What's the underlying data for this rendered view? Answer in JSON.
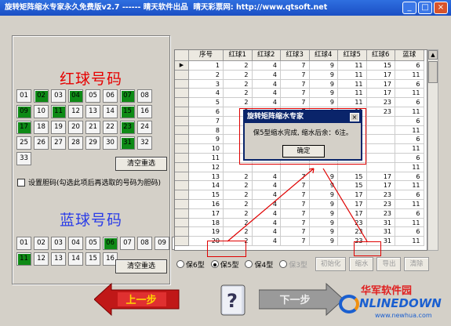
{
  "window": {
    "title": "旋转矩阵缩水专家永久免费版v2.7 ------ 晴天软件出品  晴天彩票网: http://www.qtsoft.net",
    "minimize": "_",
    "maximize": "□",
    "close": "×"
  },
  "red_heading": "红球号码",
  "blue_heading": "蓝球号码",
  "red_balls": [
    {
      "n": "01",
      "on": false
    },
    {
      "n": "02",
      "on": true
    },
    {
      "n": "03",
      "on": false
    },
    {
      "n": "04",
      "on": true
    },
    {
      "n": "05",
      "on": false
    },
    {
      "n": "06",
      "on": false
    },
    {
      "n": "07",
      "on": true
    },
    {
      "n": "08",
      "on": false
    },
    {
      "n": "09",
      "on": true
    },
    {
      "n": "10",
      "on": false
    },
    {
      "n": "11",
      "on": true
    },
    {
      "n": "12",
      "on": false
    },
    {
      "n": "13",
      "on": false
    },
    {
      "n": "14",
      "on": false
    },
    {
      "n": "15",
      "on": true
    },
    {
      "n": "16",
      "on": false
    },
    {
      "n": "17",
      "on": true
    },
    {
      "n": "18",
      "on": false
    },
    {
      "n": "19",
      "on": false
    },
    {
      "n": "20",
      "on": false
    },
    {
      "n": "21",
      "on": false
    },
    {
      "n": "22",
      "on": false
    },
    {
      "n": "23",
      "on": true
    },
    {
      "n": "24",
      "on": false
    },
    {
      "n": "25",
      "on": false
    },
    {
      "n": "26",
      "on": false
    },
    {
      "n": "27",
      "on": false
    },
    {
      "n": "28",
      "on": false
    },
    {
      "n": "29",
      "on": false
    },
    {
      "n": "30",
      "on": false
    },
    {
      "n": "31",
      "on": true
    },
    {
      "n": "32",
      "on": false
    },
    {
      "n": "33",
      "on": false
    }
  ],
  "blue_balls": [
    {
      "n": "01",
      "on": false
    },
    {
      "n": "02",
      "on": false
    },
    {
      "n": "03",
      "on": false
    },
    {
      "n": "04",
      "on": false
    },
    {
      "n": "05",
      "on": false
    },
    {
      "n": "06",
      "on": true
    },
    {
      "n": "07",
      "on": false
    },
    {
      "n": "08",
      "on": false
    },
    {
      "n": "09",
      "on": false
    },
    {
      "n": "10",
      "on": false
    },
    {
      "n": "11",
      "on": true
    },
    {
      "n": "12",
      "on": false
    },
    {
      "n": "13",
      "on": false
    },
    {
      "n": "14",
      "on": false
    },
    {
      "n": "15",
      "on": false
    },
    {
      "n": "16",
      "on": false
    }
  ],
  "clear_label": "清空重选",
  "bile_checkbox_label": "设置胆码(勾选此项后再选取的号码为胆码)",
  "table": {
    "headers": [
      "序号",
      "红球1",
      "红球2",
      "红球3",
      "红球4",
      "红球5",
      "红球6",
      "蓝球"
    ],
    "rows": [
      [
        "1",
        "2",
        "4",
        "7",
        "9",
        "11",
        "15",
        "6"
      ],
      [
        "2",
        "2",
        "4",
        "7",
        "9",
        "11",
        "17",
        "11"
      ],
      [
        "3",
        "2",
        "4",
        "7",
        "9",
        "11",
        "17",
        "6"
      ],
      [
        "4",
        "2",
        "4",
        "7",
        "9",
        "11",
        "17",
        "11"
      ],
      [
        "5",
        "2",
        "4",
        "7",
        "9",
        "11",
        "23",
        "6"
      ],
      [
        "6",
        "2",
        "4",
        "7",
        "9",
        "11",
        "23",
        "11"
      ],
      [
        "7",
        "2",
        "4",
        "7",
        "9",
        "11",
        "",
        "6"
      ],
      [
        "8",
        "",
        "",
        "",
        "",
        "",
        "",
        "11"
      ],
      [
        "9",
        "",
        "",
        "",
        "",
        "",
        "",
        "6"
      ],
      [
        "10",
        "",
        "",
        "",
        "",
        "",
        "",
        "11"
      ],
      [
        "11",
        "",
        "",
        "",
        "",
        "",
        "",
        "6"
      ],
      [
        "12",
        "",
        "",
        "",
        "",
        "",
        "",
        "11"
      ],
      [
        "13",
        "2",
        "4",
        "7",
        "9",
        "15",
        "17",
        "6"
      ],
      [
        "14",
        "2",
        "4",
        "7",
        "9",
        "15",
        "17",
        "11"
      ],
      [
        "15",
        "2",
        "4",
        "7",
        "9",
        "17",
        "23",
        "6"
      ],
      [
        "16",
        "2",
        "4",
        "7",
        "9",
        "17",
        "23",
        "11"
      ],
      [
        "17",
        "2",
        "4",
        "7",
        "9",
        "17",
        "23",
        "6"
      ],
      [
        "18",
        "2",
        "4",
        "7",
        "9",
        "23",
        "31",
        "11"
      ],
      [
        "19",
        "2",
        "4",
        "7",
        "9",
        "23",
        "31",
        "6"
      ],
      [
        "20",
        "2",
        "4",
        "7",
        "9",
        "23",
        "31",
        "11"
      ]
    ]
  },
  "modes": [
    {
      "label": "保6型",
      "selected": false,
      "enabled": true
    },
    {
      "label": "保5型",
      "selected": true,
      "enabled": true
    },
    {
      "label": "保4型",
      "selected": false,
      "enabled": true
    },
    {
      "label": "保3型",
      "selected": false,
      "enabled": false
    }
  ],
  "buttons": {
    "init": "初始化",
    "shrink": "缩水",
    "export": "导出",
    "clear": "清除"
  },
  "dialog": {
    "title": "旋转矩阵缩水专家",
    "message": "保5型缩水完成, 缩水后余：6注。",
    "ok": "确定"
  },
  "nav": {
    "prev": "上一步",
    "next": "下一步"
  },
  "logo": {
    "cn": "华军软件园",
    "en": "NLINEDOWN",
    "url": "www.newhua.com"
  }
}
